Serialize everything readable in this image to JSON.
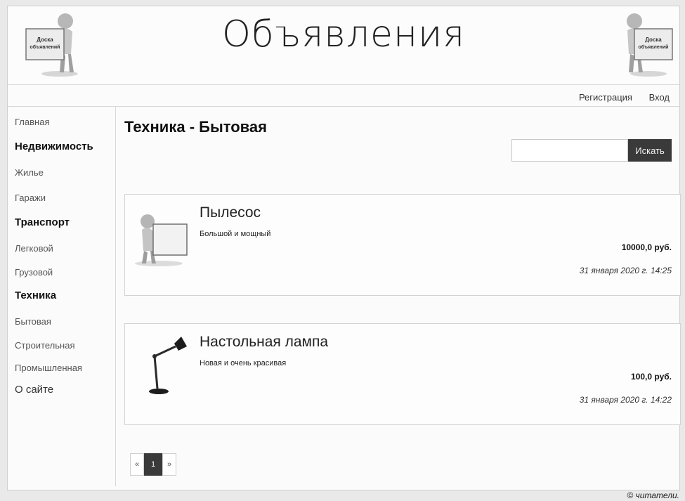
{
  "header": {
    "title": "Объявления",
    "logo_text_line1": "Доска",
    "logo_text_line2": "объявлений"
  },
  "topnav": {
    "register": "Регистрация",
    "login": "Вход"
  },
  "sidebar": {
    "items": [
      {
        "label": "Главная",
        "kind": "link"
      },
      {
        "label": "Недвижимость",
        "kind": "rubric"
      },
      {
        "label": "Жилье",
        "kind": "link"
      },
      {
        "label": "Гаражи",
        "kind": "link"
      },
      {
        "label": "Транспорт",
        "kind": "rubric"
      },
      {
        "label": "Легковой",
        "kind": "link"
      },
      {
        "label": "Грузовой",
        "kind": "link"
      },
      {
        "label": "Техника",
        "kind": "rubric"
      },
      {
        "label": "Бытовая",
        "kind": "link"
      },
      {
        "label": "Строительная",
        "kind": "link"
      },
      {
        "label": "Промышленная",
        "kind": "link"
      },
      {
        "label": "О сайте",
        "kind": "about"
      }
    ]
  },
  "main": {
    "title": "Техника - Бытовая",
    "search": {
      "value": "",
      "button": "Искать"
    },
    "ads": [
      {
        "title": "Пылесос",
        "description": "Большой и мощный",
        "price": "10000,0 руб.",
        "date": "31 января 2020 г. 14:25",
        "image_icon": "person-with-board-icon"
      },
      {
        "title": "Настольная лампа",
        "description": "Новая и очень красивая",
        "price": "100,0 руб.",
        "date": "31 января 2020 г. 14:22",
        "image_icon": "desk-lamp-icon"
      }
    ],
    "pagination": {
      "prev": "«",
      "current": "1",
      "next": "»"
    }
  },
  "footer": {
    "text": "© читатели."
  },
  "colors": {
    "accent": "#3a3a3a",
    "background": "#fbfbfb",
    "border": "#d3d3d3"
  }
}
